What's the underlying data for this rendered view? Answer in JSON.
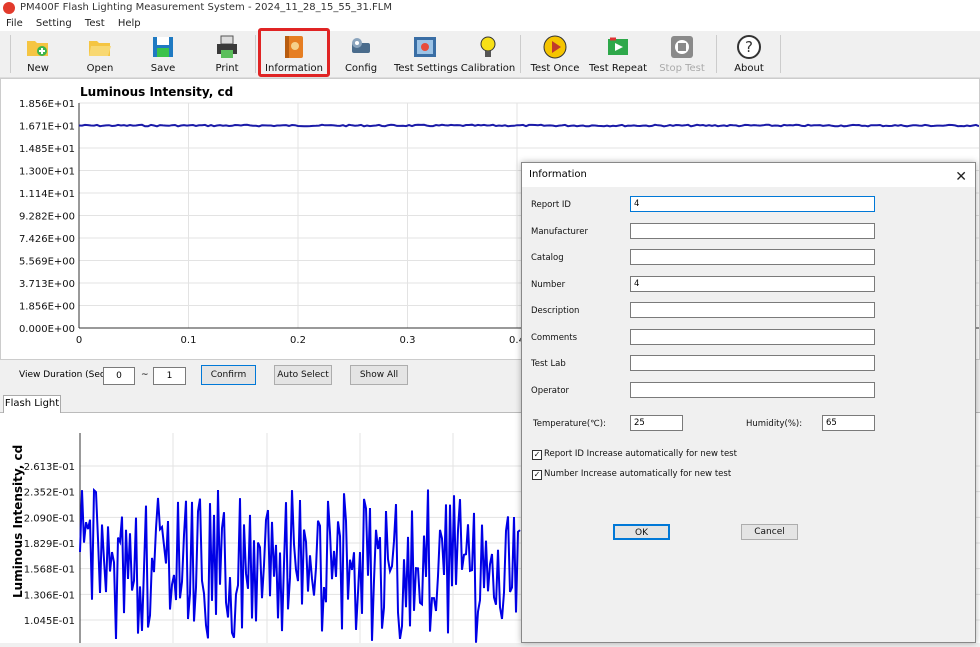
{
  "window": {
    "title": "PM400F Flash Lighting Measurement System - 2024_11_28_15_55_31.FLM"
  },
  "menu": [
    "File",
    "Setting",
    "Test",
    "Help"
  ],
  "toolbar": {
    "new": "New",
    "open": "Open",
    "save": "Save",
    "print": "Print",
    "information": "Information",
    "config": "Config",
    "test_settings": "Test Settings",
    "calibration": "Calibration",
    "test_once": "Test Once",
    "test_repeat": "Test Repeat",
    "stop_test": "Stop Test",
    "about": "About"
  },
  "top_chart": {
    "title": "Luminous Intensity, cd",
    "y_ticks": [
      "1.856E+01",
      "1.671E+01",
      "1.485E+01",
      "1.300E+01",
      "1.114E+01",
      "9.282E+00",
      "7.426E+00",
      "5.569E+00",
      "3.713E+00",
      "1.856E+00",
      "0.000E+00"
    ],
    "x_ticks": [
      "0",
      "0.1",
      "0.2",
      "0.3",
      "0.4"
    ]
  },
  "view_bar": {
    "label": "View Duration (Sec)",
    "from": "0",
    "tilde": "~",
    "to": "1",
    "confirm": "Confirm",
    "auto_select": "Auto Select",
    "show_all": "Show All"
  },
  "tab": {
    "flash_light": "Flash Light"
  },
  "bottom_chart": {
    "ylabel": "Luminous Intensity, cd",
    "y_ticks": [
      "2.613E-01",
      "2.352E-01",
      "2.090E-01",
      "1.829E-01",
      "1.568E-01",
      "1.306E-01",
      "1.045E-01"
    ]
  },
  "chart_data": [
    {
      "type": "line",
      "title": "Luminous Intensity, cd",
      "xlabel": "",
      "ylabel": "",
      "ylim": [
        0,
        18.56
      ],
      "xlim": [
        0,
        0.4
      ],
      "grid": true,
      "series": [
        {
          "values_approx_constant": 16.7
        }
      ]
    },
    {
      "type": "line",
      "title": "",
      "ylabel": "Luminous Intensity, cd",
      "ylim": [
        0.1045,
        0.2613
      ],
      "grid": true,
      "series": [
        {
          "values_range": [
            0.1,
            0.26
          ]
        }
      ]
    }
  ],
  "dialog": {
    "title": "Information",
    "close": "✕",
    "fields": {
      "report_id": {
        "label": "Report ID",
        "value": "4"
      },
      "manufacturer": {
        "label": "Manufacturer",
        "value": ""
      },
      "catalog": {
        "label": "Catalog",
        "value": ""
      },
      "number": {
        "label": "Number",
        "value": "4"
      },
      "description": {
        "label": "Description",
        "value": ""
      },
      "comments": {
        "label": "Comments",
        "value": ""
      },
      "test_lab": {
        "label": "Test Lab",
        "value": ""
      },
      "operator": {
        "label": "Operator",
        "value": ""
      }
    },
    "temperature_label": "Temperature(℃):",
    "temperature": "25",
    "humidity_label": "Humidity(%):",
    "humidity": "65",
    "check_report": "Report ID Increase automatically for new test",
    "check_number": "Number Increase automatically for new test",
    "check_mark": "✓",
    "ok": "OK",
    "cancel": "Cancel"
  }
}
